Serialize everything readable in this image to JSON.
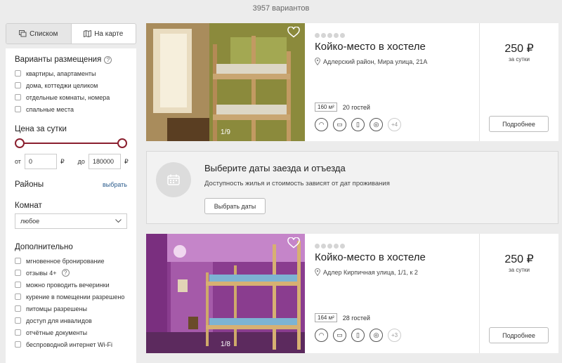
{
  "results": {
    "count_text": "3957 вариантов"
  },
  "view_toggle": {
    "list_label": "Списком",
    "map_label": "На карте"
  },
  "filters": {
    "accommodation": {
      "title": "Варианты размещения",
      "options": [
        "квартиры, апартаменты",
        "дома, коттеджи целиком",
        "отдельные комнаты, номера",
        "спальные места"
      ]
    },
    "price": {
      "title": "Цена за сутки",
      "from_label": "от",
      "from_value": "0",
      "to_label": "до",
      "to_value": "180000",
      "currency": "₽"
    },
    "districts": {
      "title": "Районы",
      "action": "выбрать"
    },
    "rooms": {
      "title": "Комнат",
      "selected": "любое"
    },
    "extra": {
      "title": "Дополнительно",
      "options": [
        "мгновенное бронирование",
        "отзывы 4+",
        "можно проводить вечеринки",
        "курение в помещении разрешено",
        "питомцы разрешены",
        "доступ для инвалидов",
        "отчётные документы",
        "беспроводной интернет Wi-Fi"
      ]
    }
  },
  "listings": [
    {
      "title": "Койко-место в хостеле",
      "address": "Адлерский район, Мира улица, 21А",
      "area": "160 м²",
      "guests": "20 гостей",
      "more_amenities": "+4",
      "photo_counter": "1/9",
      "price": "250 ₽",
      "per": "за сутки",
      "button": "Подробнее"
    },
    {
      "title": "Койко-место в хостеле",
      "address": "Адлер Кирпичная улица, 1/1, к 2",
      "area": "164 м²",
      "guests": "28 гостей",
      "more_amenities": "+3",
      "photo_counter": "1/8",
      "price": "250 ₽",
      "per": "за сутки",
      "button": "Подробнее"
    }
  ],
  "dates_banner": {
    "title": "Выберите даты заезда и отъезда",
    "subtitle": "Доступность жилья и стоимость зависят от дат проживания",
    "button": "Выбрать даты"
  },
  "colors": {
    "accent": "#8a1f2e",
    "link": "#2a5b8c"
  }
}
